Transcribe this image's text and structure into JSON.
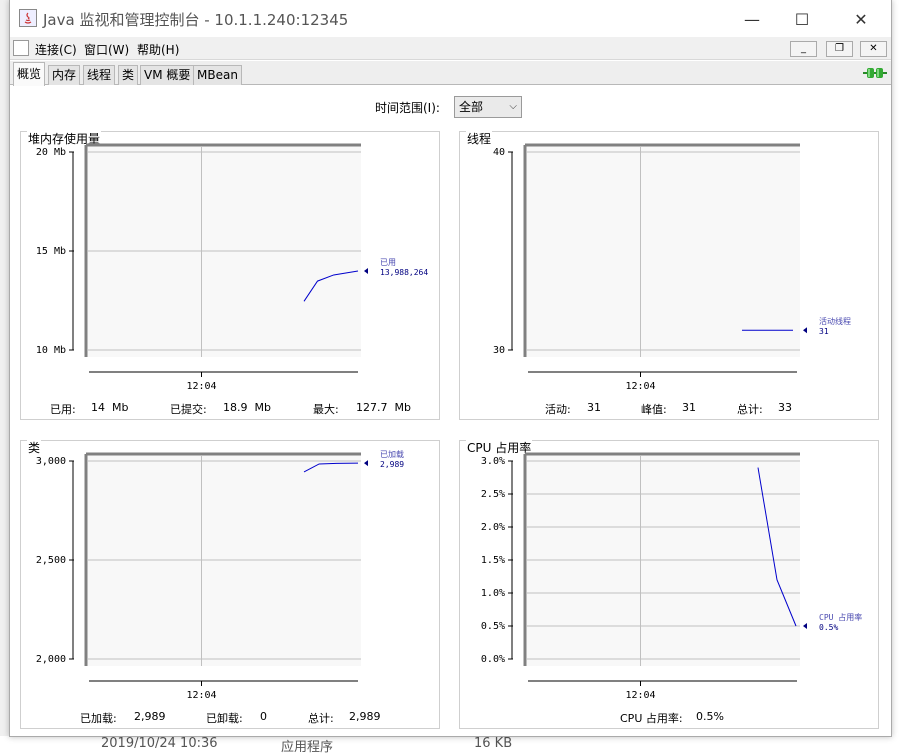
{
  "window": {
    "title": "Java 监视和管理控制台 - 10.1.1.240:12345",
    "controls": {
      "minimize": "—",
      "maximize": "☐",
      "close": "✕"
    }
  },
  "menubar": {
    "items": [
      "连接(C)",
      "窗口(W)",
      "帮助(H)"
    ],
    "mdi_buttons": [
      "_",
      "❐",
      "✕"
    ]
  },
  "tabs": [
    "概览",
    "内存",
    "线程",
    "类",
    "VM 概要",
    "MBean"
  ],
  "active_tab": "概览",
  "time_range": {
    "label": "时间范围(I):",
    "value": "全部"
  },
  "colors": {
    "line": "#0000cc",
    "grid": "#c0c0c0",
    "plot_bg": "#f8f8f8"
  },
  "background_row": [
    "2019/10/24 10:36",
    "应用程序",
    "16 KB"
  ],
  "panels": {
    "heap": {
      "title": "堆内存使用量",
      "footer": [
        [
          "已用:",
          "14  Mb"
        ],
        [
          "已提交:",
          "18.9  Mb"
        ],
        [
          "最大:",
          "127.7  Mb"
        ]
      ],
      "chart_data": {
        "type": "line",
        "yticks": [
          "20 Mb",
          "15 Mb",
          "10 Mb"
        ],
        "ylim": [
          10,
          20
        ],
        "xticks": [
          "12:04"
        ],
        "series": [
          {
            "name": "已用",
            "x": [
              0.0,
              0.25,
              0.55,
              1.0
            ],
            "y": [
              12.46,
              13.48,
              13.79,
              13.99
            ]
          }
        ],
        "legend": {
          "label": "已用",
          "value": "13,988,264"
        }
      }
    },
    "threads": {
      "title": "线程",
      "footer": [
        [
          "活动:",
          "31"
        ],
        [
          "峰值:",
          "31"
        ],
        [
          "总计:",
          "33"
        ]
      ],
      "chart_data": {
        "type": "line",
        "yticks": [
          "40",
          "30"
        ],
        "ylim": [
          30,
          40
        ],
        "xticks": [
          "12:04"
        ],
        "series": [
          {
            "name": "活动线程",
            "x": [
              0.0,
              1.0
            ],
            "y": [
              31,
              31
            ]
          }
        ],
        "legend": {
          "label": "活动线程",
          "value": "31"
        }
      }
    },
    "classes": {
      "title": "类",
      "footer": [
        [
          "已加载:",
          "2,989"
        ],
        [
          "已卸载:",
          "0"
        ],
        [
          "总计:",
          "2,989"
        ]
      ],
      "chart_data": {
        "type": "line",
        "yticks": [
          "3,000",
          "2,500",
          "2,000"
        ],
        "ylim": [
          2000,
          3000
        ],
        "xticks": [
          "12:04"
        ],
        "series": [
          {
            "name": "已加载",
            "x": [
              0.0,
              0.28,
              0.6,
              1.0
            ],
            "y": [
              2945,
              2985,
              2988,
              2989
            ]
          }
        ],
        "legend": {
          "label": "已加载",
          "value": "2,989"
        }
      }
    },
    "cpu": {
      "title": "CPU 占用率",
      "footer": [
        [
          "CPU 占用率:",
          "0.5%"
        ]
      ],
      "chart_data": {
        "type": "line",
        "yticks": [
          "3.0%",
          "2.5%",
          "2.0%",
          "1.5%",
          "1.0%",
          "0.5%",
          "0.0%"
        ],
        "ylim": [
          0,
          3
        ],
        "xticks": [
          "12:04"
        ],
        "series": [
          {
            "name": "CPU 占用率",
            "x": [
              0.0,
              0.5,
              1.0
            ],
            "y": [
              2.9,
              1.2,
              0.5
            ]
          }
        ],
        "legend": {
          "label": "CPU 占用率",
          "value": "0.5%"
        }
      }
    }
  }
}
